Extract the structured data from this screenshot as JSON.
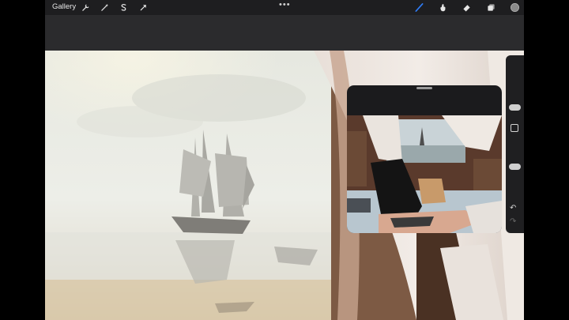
{
  "topbar": {
    "gallery_label": "Gallery",
    "tools": [
      "wrench-icon",
      "magic-wand-icon",
      "selection-icon",
      "transform-arrow-icon"
    ],
    "more_label": "•••",
    "right_tools": [
      "brush-icon",
      "smudge-icon",
      "eraser-icon",
      "layers-icon",
      "color-swatch"
    ]
  },
  "sidebar": {
    "undo_label": "↶",
    "redo_label": "↷",
    "brush_size_level": 0.6,
    "opacity_level": 0.45
  },
  "colors": {
    "accent": "#2f7cf6",
    "current_color": "#8a8a8a",
    "topbar": "#1e1e20",
    "app_bg": "#2b2b2d"
  }
}
